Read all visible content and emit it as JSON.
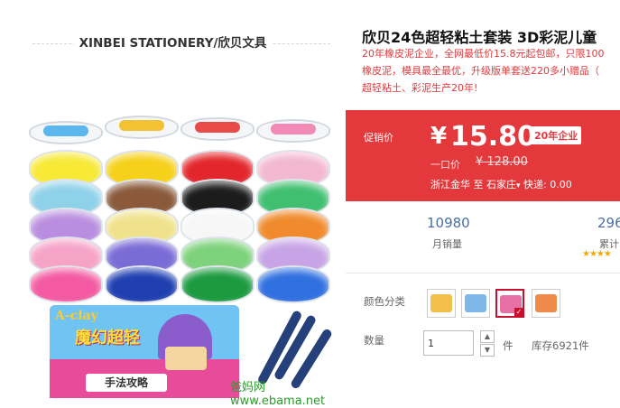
{
  "store": {
    "name": "XINBEI STATIONERY/欣贝文具"
  },
  "product": {
    "title": "欣贝24色超轻粘土套装 3D彩泥儿童",
    "description_lines": [
      "20年橡皮泥企业，全网最低价15.8元起包邮，只限100",
      "橡皮泥，模具最全最优，升级版单套送220多小赠品（",
      "超轻粘土、彩泥生产20年!"
    ],
    "image": {
      "box_logo": "A-clay",
      "box_title": "魔幻超轻",
      "box_band": "手法攻略",
      "watermark": "爸妈网 www.ebama.net"
    }
  },
  "price": {
    "label": "促销价",
    "currency": "¥",
    "value": "15.80",
    "badge": "20年企业",
    "original_label": "一口价",
    "original_value": "¥ 128.00",
    "origin": "浙江金华",
    "to": "至",
    "destination": "石家庄",
    "shipping": "快递: 0.00"
  },
  "stats": {
    "monthly_sales_value": "10980",
    "monthly_sales_label": "月销量",
    "cumulative_value": "296",
    "cumulative_label": "累计",
    "stars": "★★★★"
  },
  "options": {
    "color_label": "颜色分类",
    "swatches": [
      {
        "color": "#f3c14b",
        "selected": false
      },
      {
        "color": "#7fb8e8",
        "selected": false
      },
      {
        "color": "#e86fa5",
        "selected": true
      },
      {
        "color": "#f08a4b",
        "selected": false
      }
    ]
  },
  "quantity": {
    "label": "数量",
    "value": "1",
    "unit": "件",
    "stock": "库存6921件"
  },
  "colors": {
    "accent_red": "#e4393c",
    "link_blue": "#4a6ea9"
  }
}
